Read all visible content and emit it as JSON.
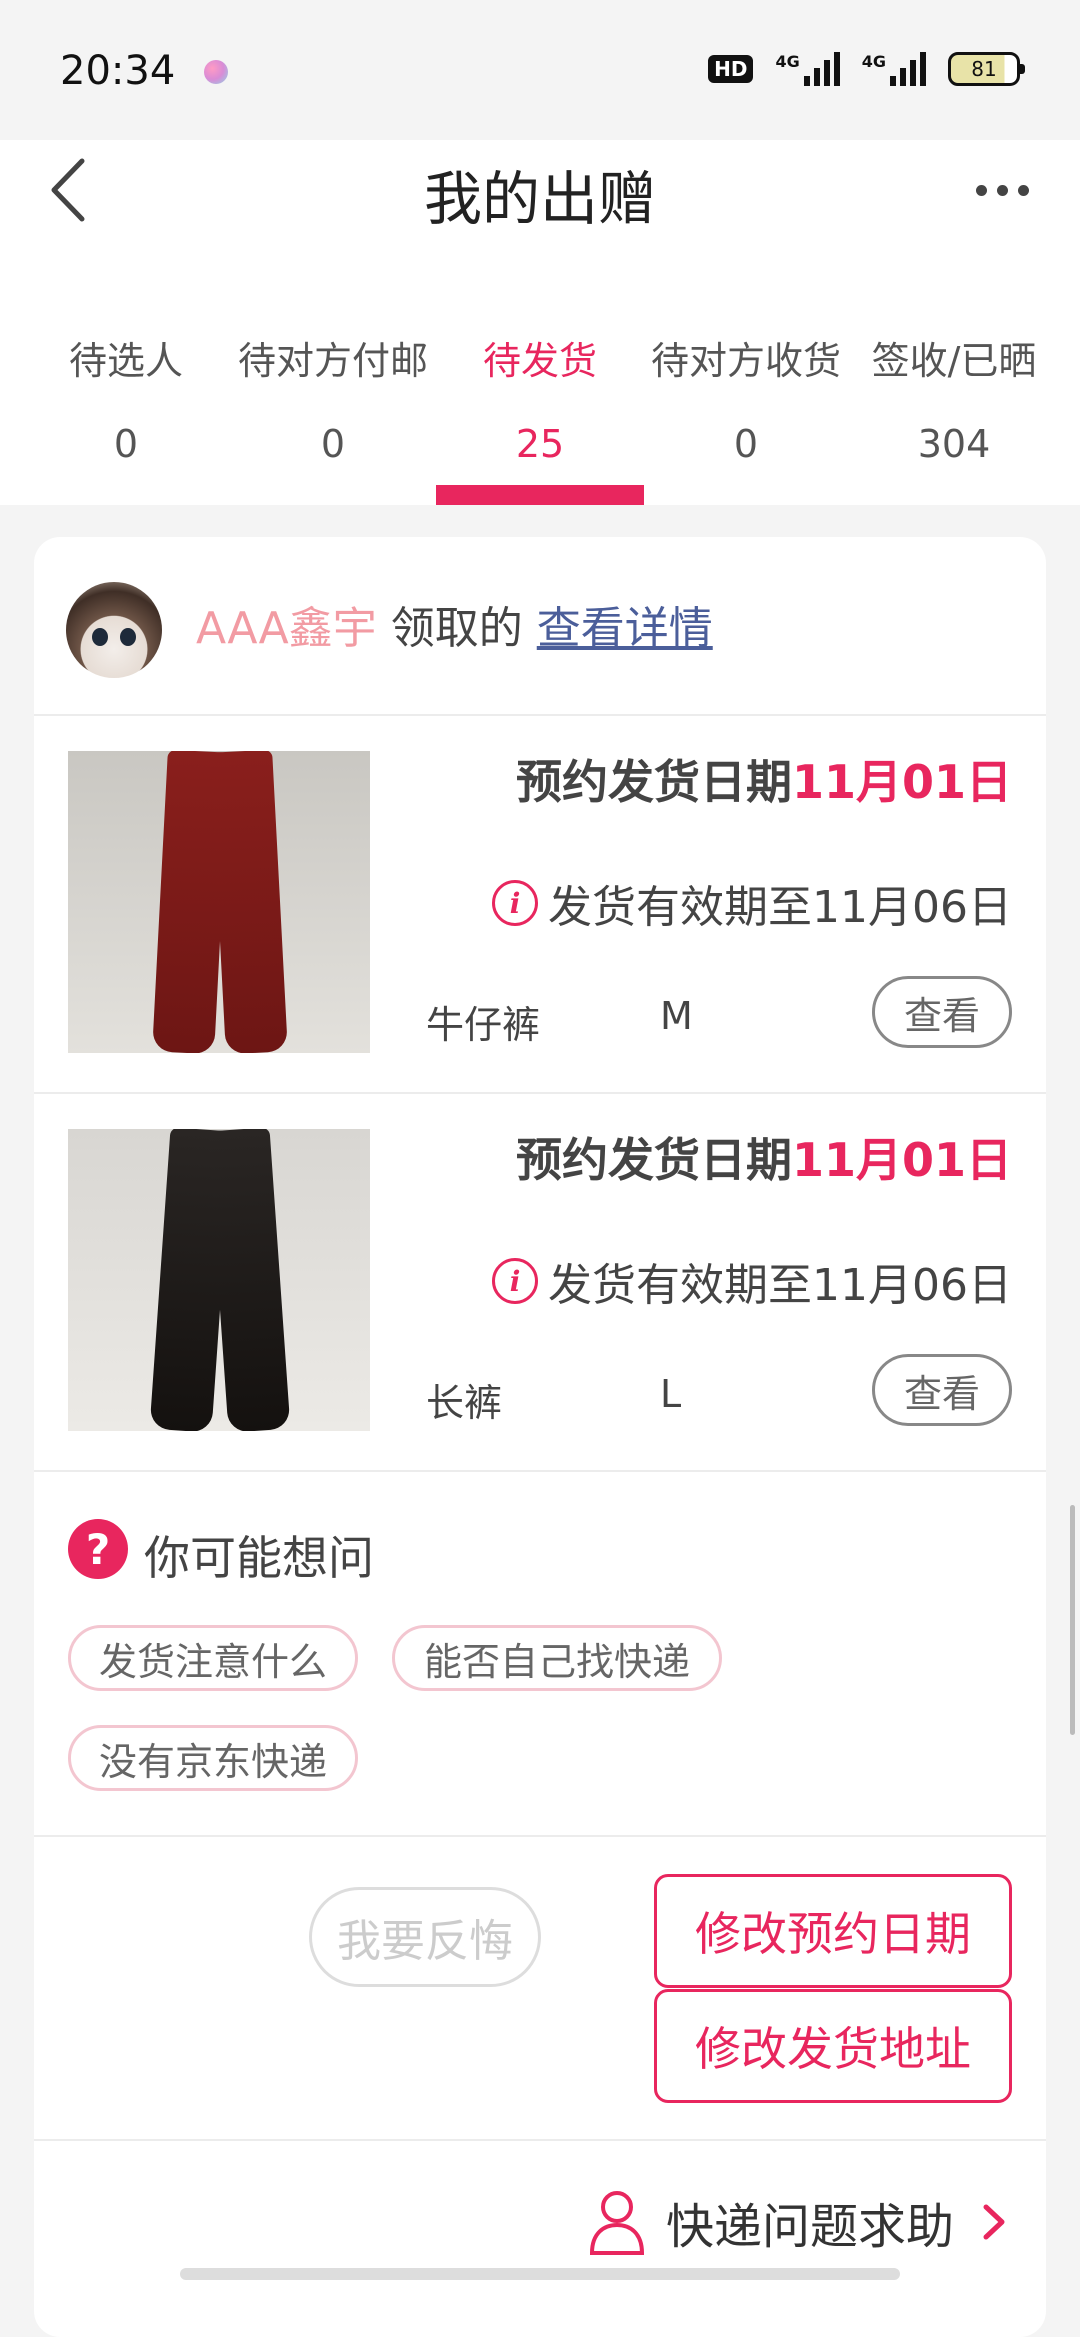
{
  "status_bar": {
    "time": "20:34",
    "hd": "HD",
    "signal_label": "4G",
    "battery": "81"
  },
  "header": {
    "title": "我的出赠"
  },
  "tabs": [
    {
      "label": "待选人",
      "count": "0"
    },
    {
      "label": "待对方付邮",
      "count": "0"
    },
    {
      "label": "待发货",
      "count": "25"
    },
    {
      "label": "待对方收货",
      "count": "0"
    },
    {
      "label": "签收/已晒",
      "count": "304"
    }
  ],
  "active_tab": "待发货",
  "order": {
    "user": "AAA鑫宇",
    "claim_text": "领取的",
    "detail_link": "查看详情",
    "items": [
      {
        "ship_prefix": "预约发货日期",
        "ship_date": "11月01日",
        "validity": "发货有效期至11月06日",
        "name": "牛仔裤",
        "size": "M",
        "view_label": "查看"
      },
      {
        "ship_prefix": "预约发货日期",
        "ship_date": "11月01日",
        "validity": "发货有效期至11月06日",
        "name": "长裤",
        "size": "L",
        "view_label": "查看"
      }
    ]
  },
  "faq": {
    "title": "你可能想问",
    "chips": [
      "发货注意什么",
      "能否自己找快递",
      "没有京东快递"
    ]
  },
  "actions": {
    "regret": "我要反悔",
    "change_date": "修改预约日期",
    "change_address": "修改发货地址"
  },
  "help": {
    "label": "快递问题求助"
  },
  "colors": {
    "accent": "#e8265e",
    "user_name": "#f29ba3",
    "link": "#4b5e9a"
  }
}
